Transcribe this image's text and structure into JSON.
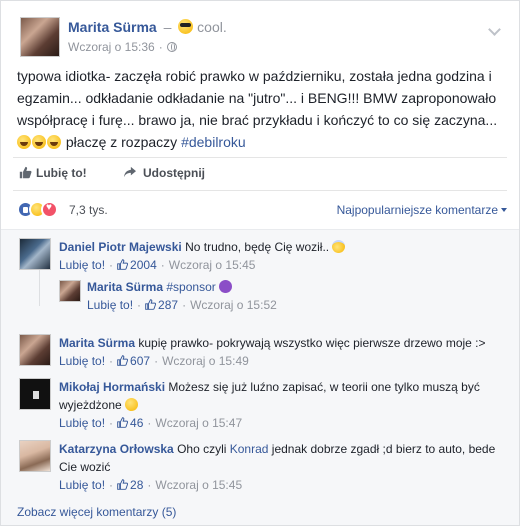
{
  "post": {
    "author": "Marita Sürma",
    "feeling_separator": "–",
    "feeling_icon": "cool-face-emoji",
    "feeling": "cool.",
    "time": "Wczoraj o 15:36",
    "meta_separator": "·",
    "privacy_icon": "globe-icon",
    "text_main": "typowa idiotka- zaczęła robić prawko w październiku, została jedna godzina i egzamin... odkładanie odkładanie na \"jutro\"... i BENG!!! BMW zaproponowało współpracę i furę... brawo ja, nie brać przykładu i kończyć to co się zaczyna... ",
    "text_after_emojis": " płaczę z rozpaczy ",
    "hashtag": "#debilroku"
  },
  "actions": {
    "like": "Lubię to!",
    "share": "Udostępnij"
  },
  "reactions": {
    "count": "7,3 tys.",
    "sort": "Najpopularniejsze komentarze"
  },
  "comments": [
    {
      "author": "Daniel Piotr Majewski",
      "text": "No trudno, będę Cię woził.. ",
      "emoji": "angel-emoji",
      "like_label": "Lubię to!",
      "likes": "2004",
      "time": "Wczoraj o 15:45"
    },
    {
      "author": "Marita Sürma",
      "text": "kupię prawko- pokrywają wszystko więc pierwsze drzewo moje :>",
      "like_label": "Lubię to!",
      "likes": "607",
      "time": "Wczoraj o 15:49"
    },
    {
      "author": "Mikołaj Hormański",
      "text": "Możesz się już luźno zapisać, w teorii one tylko muszą być wyjeżdżone ",
      "emoji": "laugh-emoji",
      "like_label": "Lubię to!",
      "likes": "46",
      "time": "Wczoraj o 15:47"
    },
    {
      "author": "Katarzyna Orłowska",
      "text_before": "Oho czyli ",
      "mention": "Konrad",
      "text_after": " jednak dobrze zgadł ;d bierz to auto, bede Cie wozić",
      "like_label": "Lubię to!",
      "likes": "28",
      "time": "Wczoraj o 15:45"
    }
  ],
  "reply": {
    "author": "Marita Sürma",
    "text": "#sponsor ",
    "emoji": "devil-emoji",
    "like_label": "Lubię to!",
    "likes": "287",
    "time": "Wczoraj o 15:52"
  },
  "dot": "·",
  "see_more": "Zobacz więcej komentarzy (5)",
  "colors": {
    "link": "#365899",
    "meta": "#90949c",
    "like_reaction": "#4267b2",
    "love_reaction": "#f25268"
  }
}
